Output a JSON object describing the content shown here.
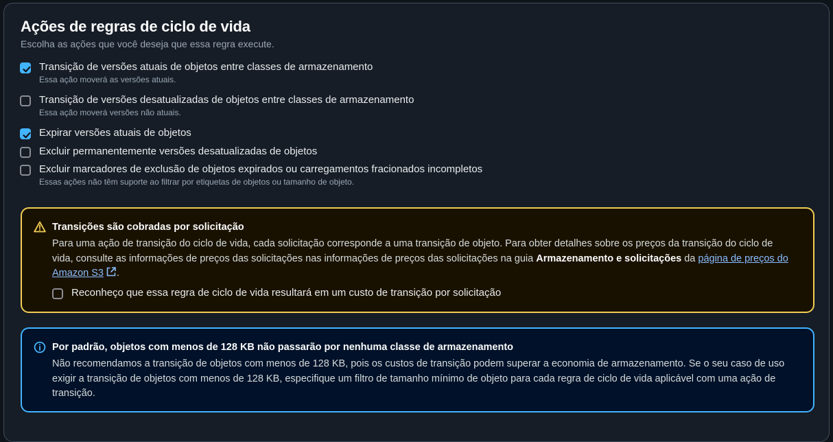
{
  "section": {
    "title": "Ações de regras de ciclo de vida",
    "subtitle": "Escolha as ações que você deseja que essa regra execute."
  },
  "actions": [
    {
      "label": "Transição de versões atuais de objetos entre classes de armazenamento",
      "description": "Essa ação moverá as versões atuais.",
      "checked": true
    },
    {
      "label": "Transição de versões desatualizadas de objetos entre classes de armazenamento",
      "description": "Essa ação moverá versões não atuais.",
      "checked": false
    },
    {
      "label": "Expirar versões atuais de objetos",
      "description": "",
      "checked": true
    },
    {
      "label": "Excluir permanentemente versões desatualizadas de objetos",
      "description": "",
      "checked": false
    },
    {
      "label": "Excluir marcadores de exclusão de objetos expirados ou carregamentos fracionados incompletos",
      "description": "Essas ações não têm suporte ao filtrar por etiquetas de objetos ou tamanho de objeto.",
      "checked": false
    }
  ],
  "warning": {
    "icon": "warning-icon",
    "title": "Transições são cobradas por solicitação",
    "body_text_1": "Para uma ação de transição do ciclo de vida, cada solicitação corresponde a uma transição de objeto. Para obter detalhes sobre os preços da transição do ciclo de vida, consulte as informações de preços das solicitações nas informações de preços das solicitações na guia ",
    "body_bold": "Armazenamento e solicitações",
    "body_text_2": " da ",
    "link_text": "página de preços do Amazon S3",
    "body_end": ".",
    "acknowledge_label": "Reconheço que essa regra de ciclo de vida resultará em um custo de transição por solicitação",
    "acknowledge_checked": false
  },
  "info": {
    "icon": "info-icon",
    "title": "Por padrão, objetos com menos de 128 KB não passarão por nenhuma classe de armazenamento",
    "body": "Não recomendamos a transição de objetos com menos de 128 KB, pois os custos de transição podem superar a economia de armazenamento. Se o seu caso de uso exigir a transição de objetos com menos de 128 KB, especifique um filtro de tamanho mínimo de objeto para cada regra de ciclo de vida aplicável com uma ação de transição."
  },
  "colors": {
    "accent": "#42b4ff",
    "warning": "#f2cd54",
    "link": "#89bdff"
  }
}
